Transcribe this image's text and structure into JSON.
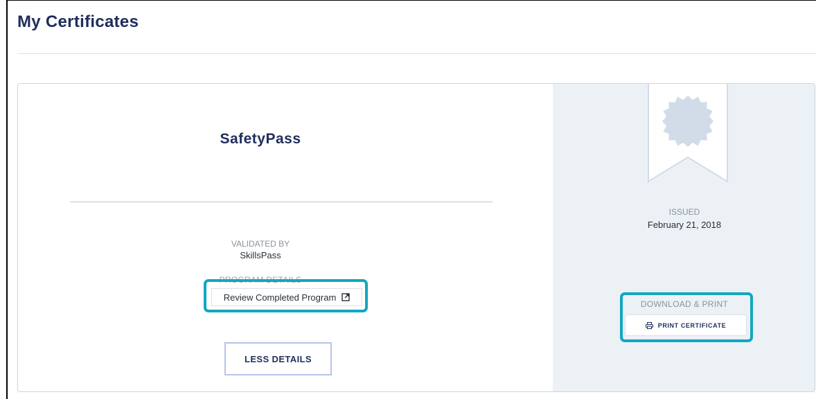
{
  "page": {
    "title": "My Certificates"
  },
  "certificate": {
    "name": "SafetyPass",
    "validated_by_label": "VALIDATED BY",
    "validated_by_value": "SkillsPass",
    "program_details_label": "PROGRAM DETAILS",
    "review_button_label": "Review Completed Program",
    "review_button_icon": "external-link-icon",
    "less_details_label": "LESS DETAILS",
    "badge_icon": "ribbon-badge-icon",
    "issued_label": "ISSUED",
    "issued_date": "February 21, 2018",
    "download_label": "DOWNLOAD & PRINT",
    "print_button_label": "PRINT CERTIFICATE",
    "print_button_icon": "printer-icon"
  },
  "colors": {
    "title": "#1f2d5c",
    "highlight": "#11a7c0",
    "panel_background": "#ecf1f6",
    "badge": "#d2dce8"
  }
}
